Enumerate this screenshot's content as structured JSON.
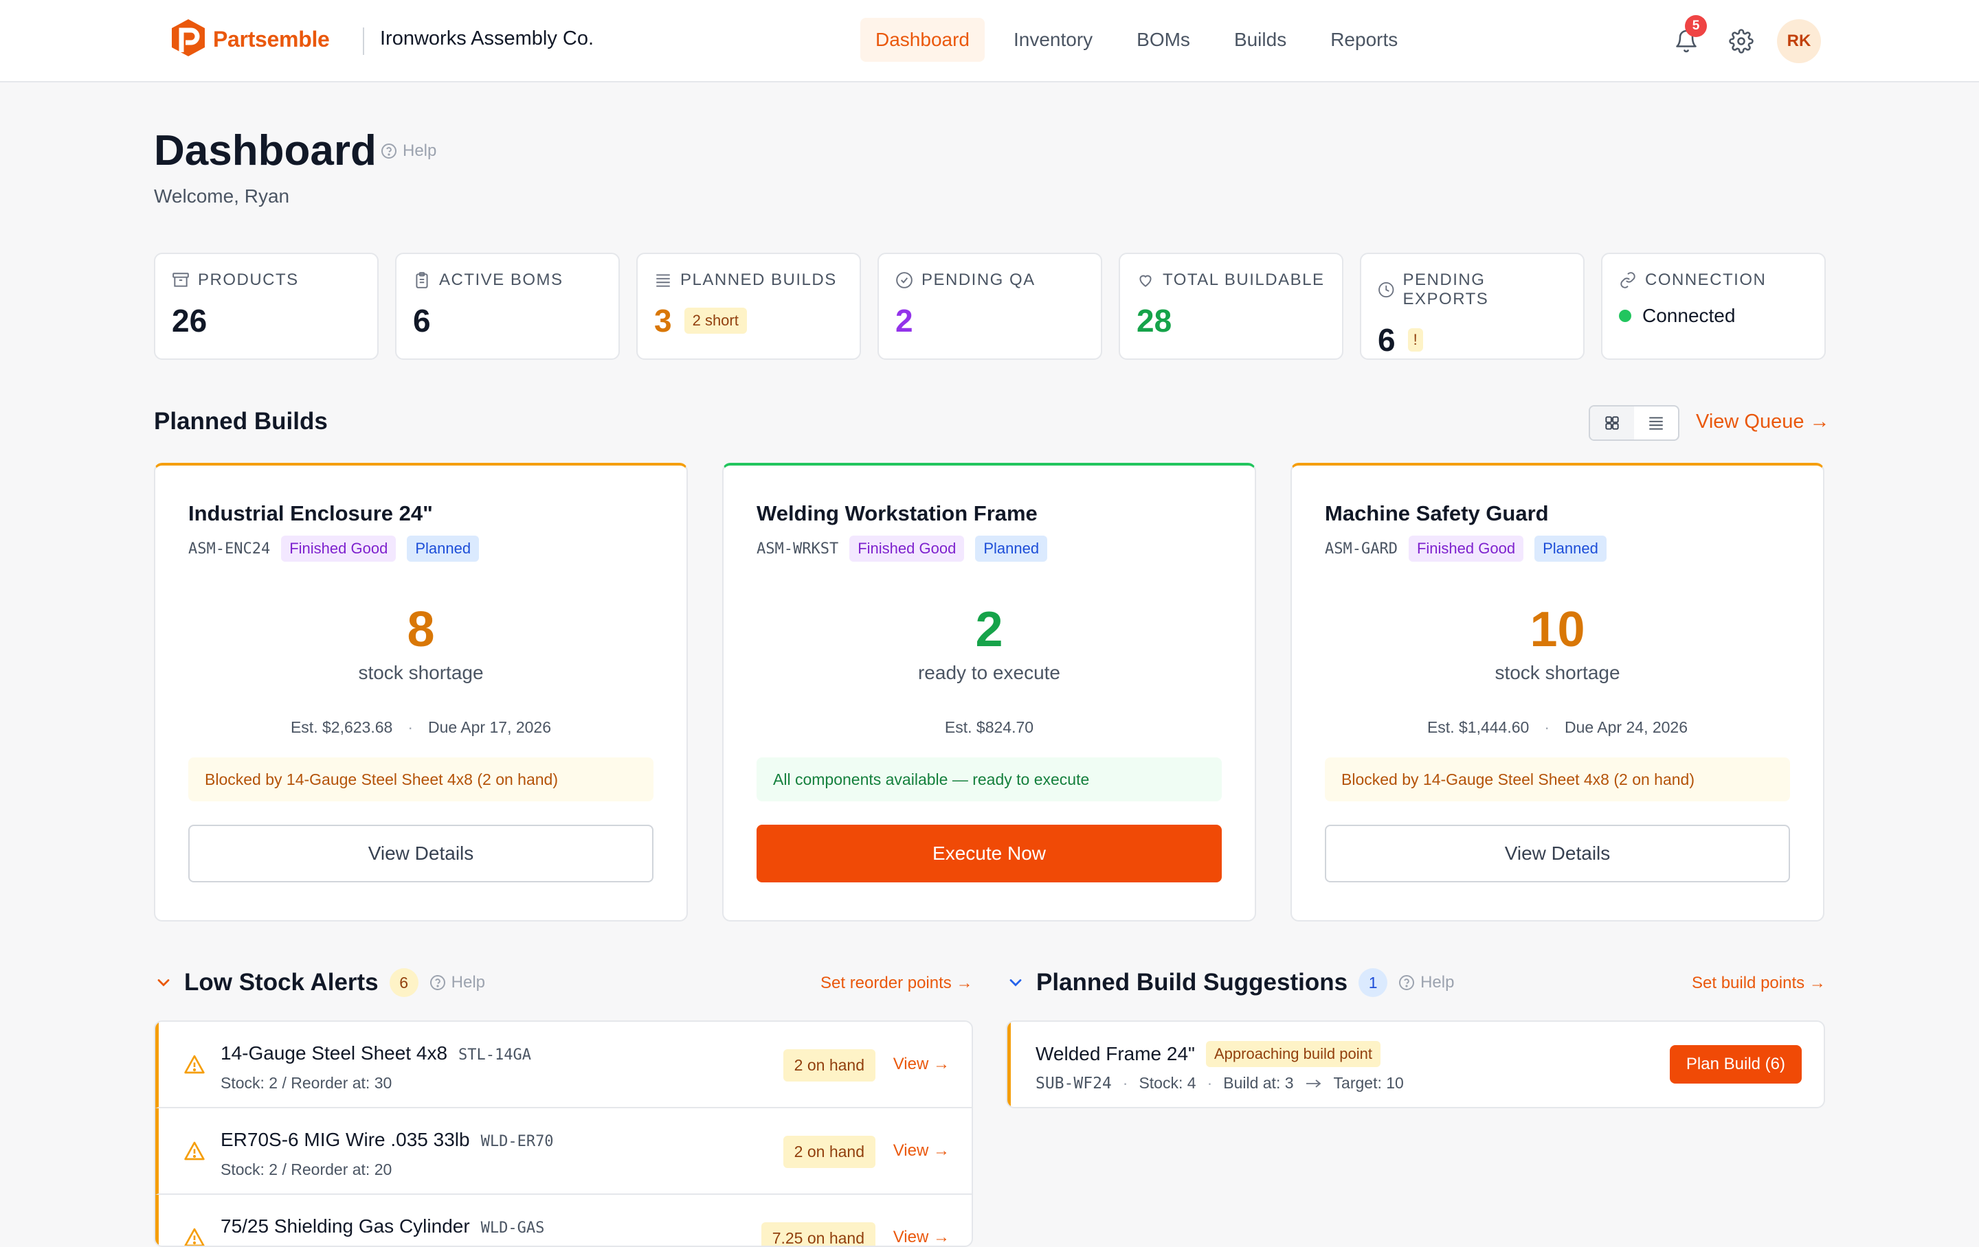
{
  "app": {
    "name": "Partsemble",
    "company": "Ironworks Assembly Co.",
    "avatar_initials": "RK",
    "notification_count": "5",
    "brand_color": "#ea580c"
  },
  "nav": [
    {
      "label": "Dashboard",
      "active": true
    },
    {
      "label": "Inventory"
    },
    {
      "label": "BOMs"
    },
    {
      "label": "Builds"
    },
    {
      "label": "Reports"
    }
  ],
  "header": {
    "title": "Dashboard",
    "help": "Help",
    "welcome": "Welcome, Ryan"
  },
  "stats": {
    "products": {
      "label": "PRODUCTS",
      "value": "26",
      "icon": "archive-icon"
    },
    "active_boms": {
      "label": "ACTIVE BOMS",
      "value": "6",
      "icon": "clipboard-icon"
    },
    "planned_builds": {
      "label": "PLANNED BUILDS",
      "value": "3",
      "chip": "2 short",
      "icon": "list-icon"
    },
    "pending_qa": {
      "label": "PENDING QA",
      "value": "2",
      "icon": "check-circle-icon"
    },
    "total_buildable": {
      "label": "TOTAL BUILDABLE",
      "value": "28",
      "icon": "heart-icon"
    },
    "pending_exports": {
      "label": "PENDING EXPORTS",
      "value": "6",
      "chip": "!",
      "icon": "clock-icon"
    },
    "connection": {
      "label": "CONNECTION",
      "value": "Connected",
      "icon": "link-icon"
    }
  },
  "planned_builds": {
    "title": "Planned Builds",
    "view_queue": "View Queue →",
    "cards": [
      {
        "name": "Industrial Enclosure 24\"",
        "sku": "ASM-ENC24",
        "tag1": "Finished Good",
        "tag2": "Planned",
        "number": "8",
        "caption": "stock shortage",
        "est": "Est. $2,623.68",
        "due": "Due Apr 17, 2026",
        "note": "Blocked by 14-Gauge Steel Sheet 4x8 (2 on hand)",
        "button": "View Details"
      },
      {
        "name": "Welding Workstation Frame",
        "sku": "ASM-WRKST",
        "tag1": "Finished Good",
        "tag2": "Planned",
        "number": "2",
        "caption": "ready to execute",
        "est": "Est. $824.70",
        "note": "All components available — ready to execute",
        "button": "Execute Now"
      },
      {
        "name": "Machine Safety Guard",
        "sku": "ASM-GARD",
        "tag1": "Finished Good",
        "tag2": "Planned",
        "number": "10",
        "caption": "stock shortage",
        "est": "Est. $1,444.60",
        "due": "Due Apr 24, 2026",
        "note": "Blocked by 14-Gauge Steel Sheet 4x8 (2 on hand)",
        "button": "View Details"
      }
    ]
  },
  "low_stock": {
    "title": "Low Stock Alerts",
    "count": "6",
    "help": "Help",
    "link": "Set reorder points →",
    "items": [
      {
        "name": "14-Gauge Steel Sheet 4x8",
        "sku": "STL-14GA",
        "sub": "Stock: 2 / Reorder at: 30",
        "onhand": "2 on hand",
        "view": "View →"
      },
      {
        "name": "ER70S-6 MIG Wire .035 33lb",
        "sku": "WLD-ER70",
        "sub": "Stock: 2 / Reorder at: 20",
        "onhand": "2 on hand",
        "view": "View →"
      },
      {
        "name": "75/25 Shielding Gas Cylinder",
        "sku": "WLD-GAS",
        "sub": "",
        "onhand": "7.25 on hand",
        "view": "View →"
      }
    ]
  },
  "suggestions": {
    "title": "Planned Build Suggestions",
    "count": "1",
    "help": "Help",
    "link": "Set build points →",
    "items": [
      {
        "name": "Welded Frame 24\"",
        "tag": "Approaching build point",
        "sku": "SUB-WF24",
        "stock": "Stock: 4",
        "build_at": "Build at: 3",
        "target": "Target: 10",
        "button": "Plan Build (6)"
      }
    ]
  }
}
